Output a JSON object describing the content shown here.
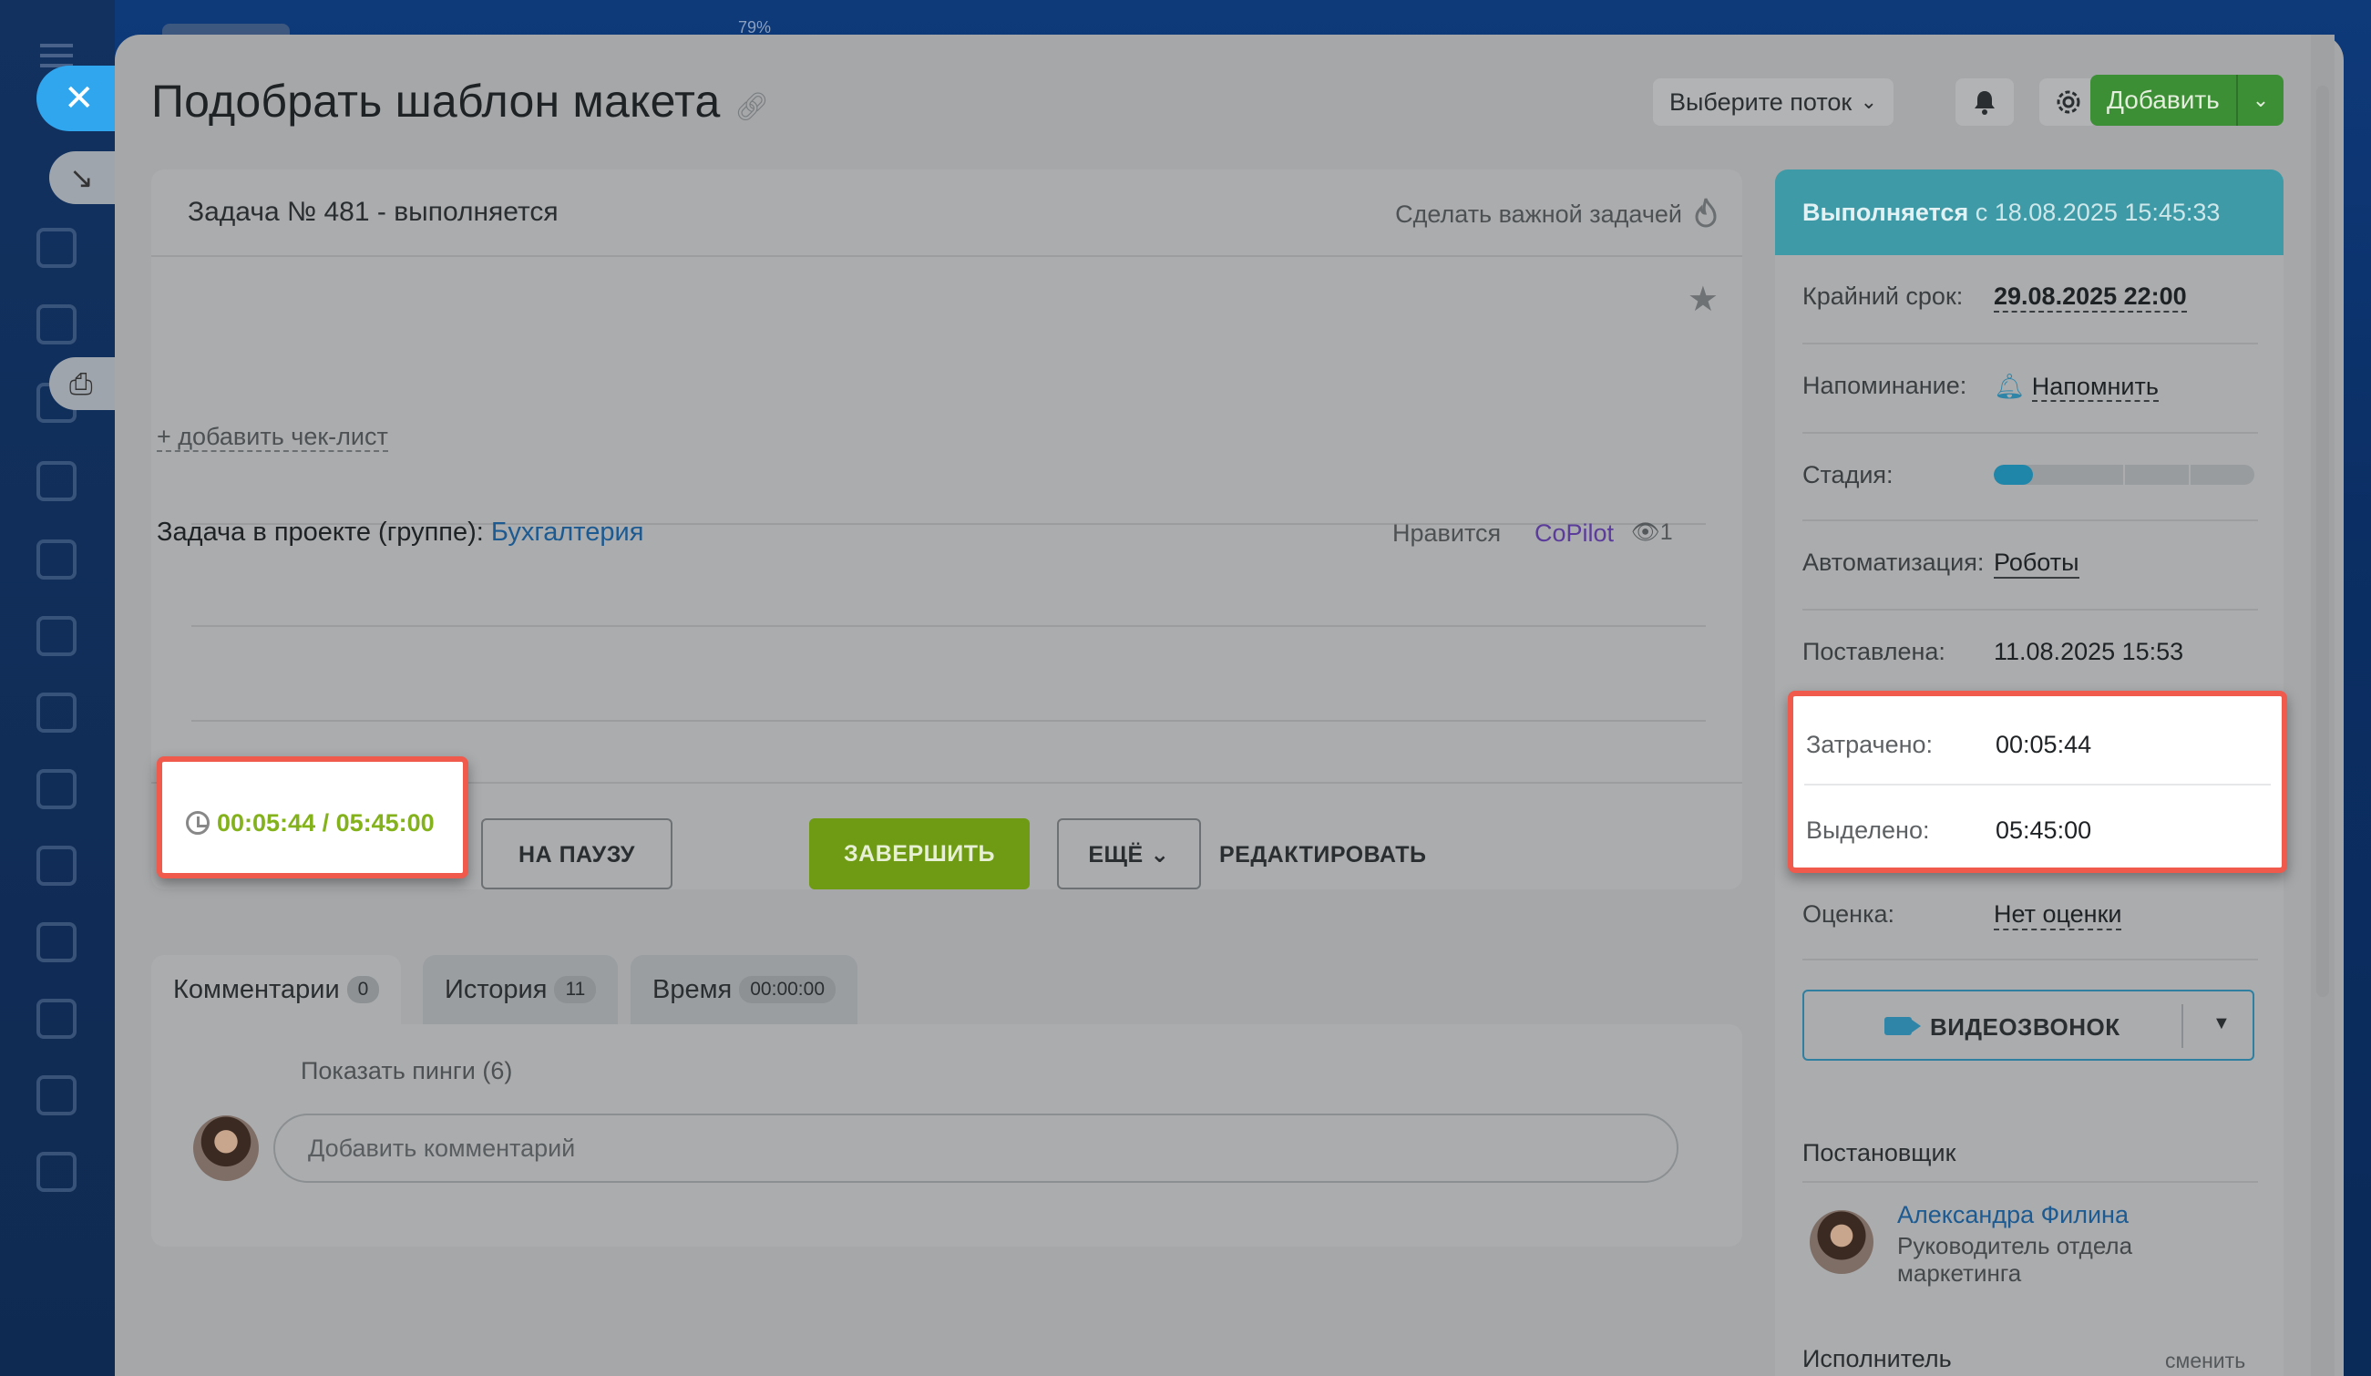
{
  "header": {
    "title": "Подобрать шаблон макета",
    "flow_select": "Выберите поток",
    "add_label": "Добавить",
    "top_percent": "79%"
  },
  "task": {
    "number_status": "Задача № 481 - выполняется",
    "make_important": "Сделать важной задачей",
    "add_checklist": "+ добавить чек-лист",
    "project_label": "Задача в проекте (группе):",
    "project_name": "Бухгалтерия",
    "likes": "Нравится",
    "copilot": "CoPilot",
    "views": "1",
    "timer": "00:05:44 / 05:45:00"
  },
  "actions": {
    "pause": "НА ПАУЗУ",
    "finish": "ЗАВЕРШИТЬ",
    "more": "ЕЩЁ",
    "edit": "РЕДАКТИРОВАТЬ"
  },
  "tabs": [
    {
      "label": "Комментарии",
      "count": "0"
    },
    {
      "label": "История",
      "count": "11"
    },
    {
      "label": "Время",
      "count": "00:00:00"
    }
  ],
  "comments": {
    "show_pings": "Показать пинги (6)",
    "placeholder": "Добавить комментарий"
  },
  "sidebar": {
    "status_bold": "Выполняется",
    "status_rest": "с 18.08.2025 15:45:33",
    "deadline_label": "Крайний срок:",
    "deadline_value": "29.08.2025 22:00",
    "reminder_label": "Напоминание:",
    "reminder_value": "Напомнить",
    "stage_label": "Стадия:",
    "stage_progress": 0.15,
    "automation_label": "Автоматизация:",
    "automation_value": "Роботы",
    "created_label": "Поставлена:",
    "created_value": "11.08.2025 15:53",
    "spent_label": "Затрачено:",
    "spent_value": "00:05:44",
    "allocated_label": "Выделено:",
    "allocated_value": "05:45:00",
    "rating_label": "Оценка:",
    "rating_value": "Нет оценки",
    "video_call": "ВИДЕОЗВОНОК",
    "creator_title": "Постановщик",
    "creator_name": "Александра Филина",
    "creator_role": "Руководитель отдела маркетинга",
    "assignee_title": "Исполнитель",
    "change": "сменить"
  },
  "colors": {
    "accent_green": "#3d8f35",
    "timer_green": "#84b21d",
    "highlight_red": "#ef5a4d",
    "status_teal": "#3e9aa6"
  }
}
